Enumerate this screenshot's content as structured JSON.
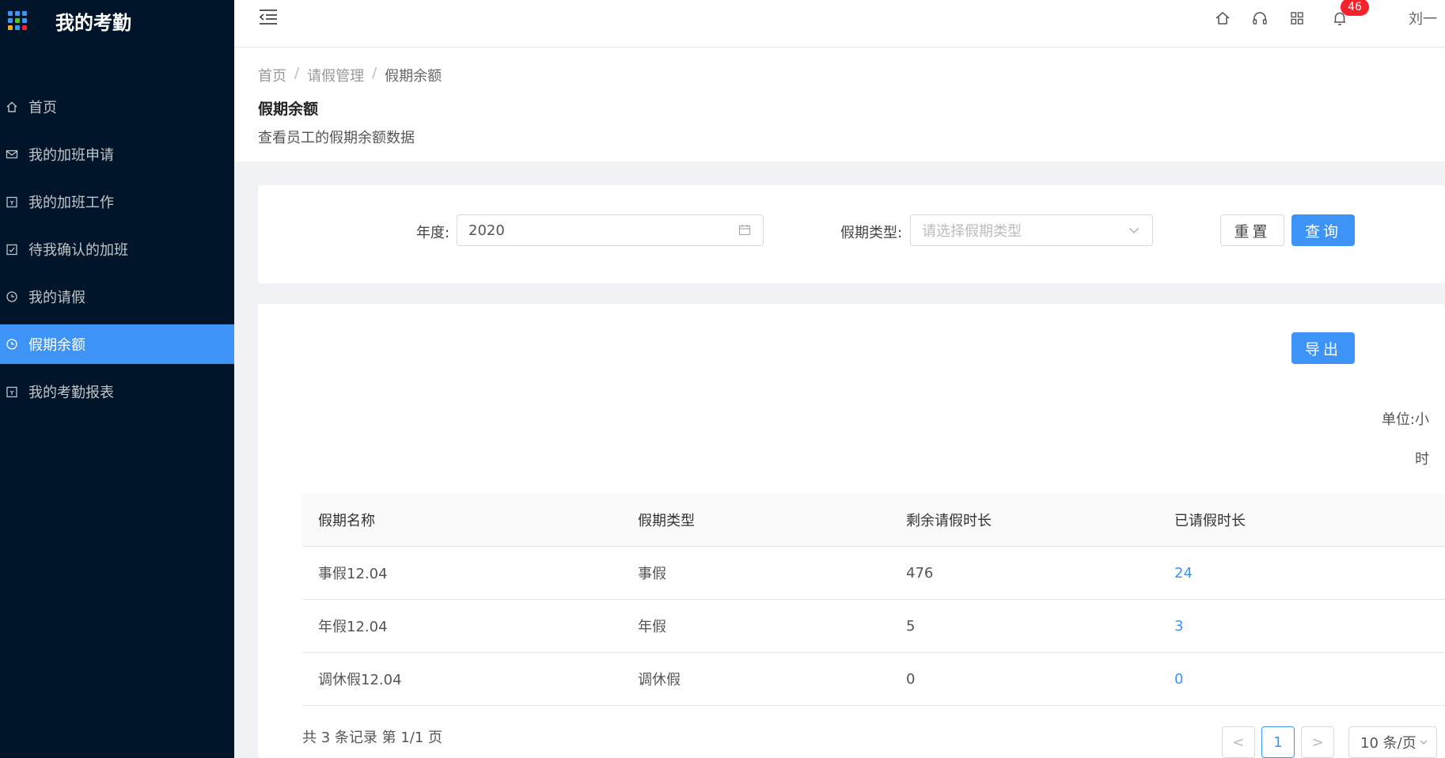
{
  "app": {
    "title": "我的考勤",
    "brand_dot_colors": [
      "#3d94f6",
      "#3d94f6",
      "#3d94f6",
      "#3d94f6",
      "#52c41a",
      "#3d94f6",
      "#f5a623",
      "#3d94f6",
      "#f5222d"
    ]
  },
  "sidebar": {
    "items": [
      {
        "label": "首页",
        "icon": "home-icon"
      },
      {
        "label": "我的加班申请",
        "icon": "mail-icon"
      },
      {
        "label": "我的加班工作",
        "icon": "calendar-icon"
      },
      {
        "label": "待我确认的加班",
        "icon": "calendar-check-icon"
      },
      {
        "label": "我的请假",
        "icon": "clock-icon"
      },
      {
        "label": "假期余额",
        "icon": "clock-icon",
        "active": true
      },
      {
        "label": "我的考勤报表",
        "icon": "calendar-icon"
      }
    ]
  },
  "header": {
    "notification_count": "46",
    "user_name": "刘一"
  },
  "breadcrumb": {
    "items": [
      "首页",
      "请假管理",
      "假期余额"
    ],
    "separator": "/"
  },
  "page": {
    "title": "假期余额",
    "description": "查看员工的假期余额数据"
  },
  "filter": {
    "year_label": "年度:",
    "year_value": "2020",
    "type_label": "假期类型:",
    "type_placeholder": "请选择假期类型",
    "reset_label": "重置",
    "query_label": "查询"
  },
  "table": {
    "export_label": "导出",
    "unit_label": "单位:小时",
    "columns": [
      "假期名称",
      "假期类型",
      "剩余请假时长",
      "已请假时长"
    ],
    "rows": [
      {
        "name": "事假12.04",
        "type": "事假",
        "remaining": "476",
        "used": "24"
      },
      {
        "name": "年假12.04",
        "type": "年假",
        "remaining": "5",
        "used": "3"
      },
      {
        "name": "调休假12.04",
        "type": "调休假",
        "remaining": "0",
        "used": "0"
      }
    ]
  },
  "pagination": {
    "summary": "共 3 条记录 第 1/1 页",
    "current_page": "1",
    "prev": "<",
    "next": ">",
    "page_size": "10 条/页"
  },
  "colors": {
    "sidebar_bg": "#001529",
    "accent": "#3d94f6",
    "badge": "#f5222d"
  }
}
